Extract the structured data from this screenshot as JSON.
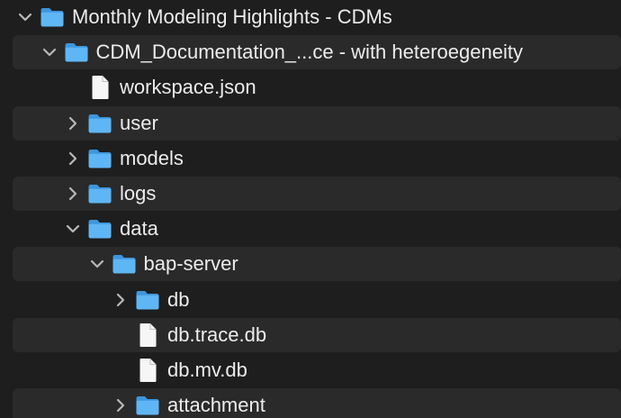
{
  "window": {
    "background": "#1e1e1e",
    "alt_row": "#2a2a2a"
  },
  "colors": {
    "folder_front": "#5fb6f5",
    "folder_back": "#3e96dc",
    "file": "#f6f6f6",
    "chevron": "#b8b8b8"
  },
  "items": [
    {
      "label": "Monthly Modeling Highlights - CDMs",
      "type": "folder",
      "depth": 0,
      "expanded": true,
      "chevron": "chevron-down-icon",
      "icon": "folder-icon"
    },
    {
      "label": "CDM_Documentation_...ce - with heteroegeneity",
      "type": "folder",
      "depth": 1,
      "expanded": true,
      "chevron": "chevron-down-icon",
      "icon": "folder-icon"
    },
    {
      "label": "workspace.json",
      "type": "file",
      "depth": 2,
      "icon": "document-icon"
    },
    {
      "label": "user",
      "type": "folder",
      "depth": 2,
      "expanded": false,
      "chevron": "chevron-right-icon",
      "icon": "folder-icon"
    },
    {
      "label": "models",
      "type": "folder",
      "depth": 2,
      "expanded": false,
      "chevron": "chevron-right-icon",
      "icon": "folder-icon"
    },
    {
      "label": "logs",
      "type": "folder",
      "depth": 2,
      "expanded": false,
      "chevron": "chevron-right-icon",
      "icon": "folder-icon"
    },
    {
      "label": "data",
      "type": "folder",
      "depth": 2,
      "expanded": true,
      "chevron": "chevron-down-icon",
      "icon": "folder-icon"
    },
    {
      "label": "bap-server",
      "type": "folder",
      "depth": 3,
      "expanded": true,
      "chevron": "chevron-down-icon",
      "icon": "folder-icon"
    },
    {
      "label": "db",
      "type": "folder",
      "depth": 4,
      "expanded": false,
      "chevron": "chevron-right-icon",
      "icon": "folder-icon"
    },
    {
      "label": "db.trace.db",
      "type": "file",
      "depth": 4,
      "icon": "document-icon"
    },
    {
      "label": "db.mv.db",
      "type": "file",
      "depth": 4,
      "icon": "document-icon"
    },
    {
      "label": "attachment",
      "type": "folder",
      "depth": 4,
      "expanded": false,
      "chevron": "chevron-right-icon",
      "icon": "folder-icon"
    }
  ]
}
